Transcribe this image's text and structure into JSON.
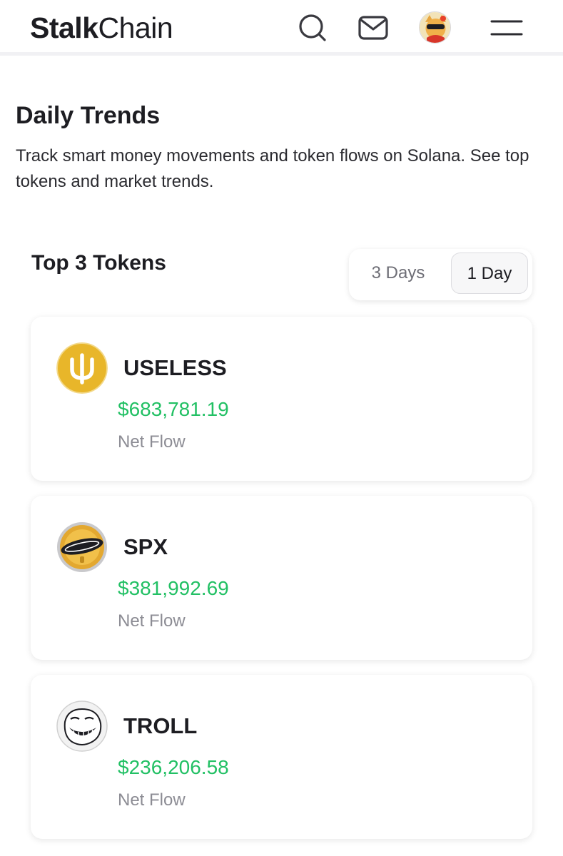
{
  "header": {
    "logo_bold": "Stalk",
    "logo_light": "Chain",
    "icons": [
      "search-icon",
      "mail-icon",
      "avatar",
      "menu-icon"
    ]
  },
  "intro": {
    "title": "Daily Trends",
    "description": "Track smart money movements and token flows on Solana. See top tokens and market trends."
  },
  "tokens_section": {
    "title": "Top 3 Tokens",
    "range_options": [
      "3 Days",
      "1 Day"
    ],
    "selected_range": "1 Day",
    "tokens": [
      {
        "name": "USELESS",
        "net_flow": "$683,781.19",
        "caption": "Net Flow",
        "logo": "useless-token-icon"
      },
      {
        "name": "SPX",
        "net_flow": "$381,992.69",
        "caption": "Net Flow",
        "logo": "spx-token-icon"
      },
      {
        "name": "TROLL",
        "net_flow": "$236,206.58",
        "caption": "Net Flow",
        "logo": "troll-token-icon"
      }
    ]
  },
  "colors": {
    "positive": "#22c064",
    "text_primary": "#1d1d22",
    "text_muted": "#8c8c94",
    "useless_gold": "#e8b62a"
  }
}
